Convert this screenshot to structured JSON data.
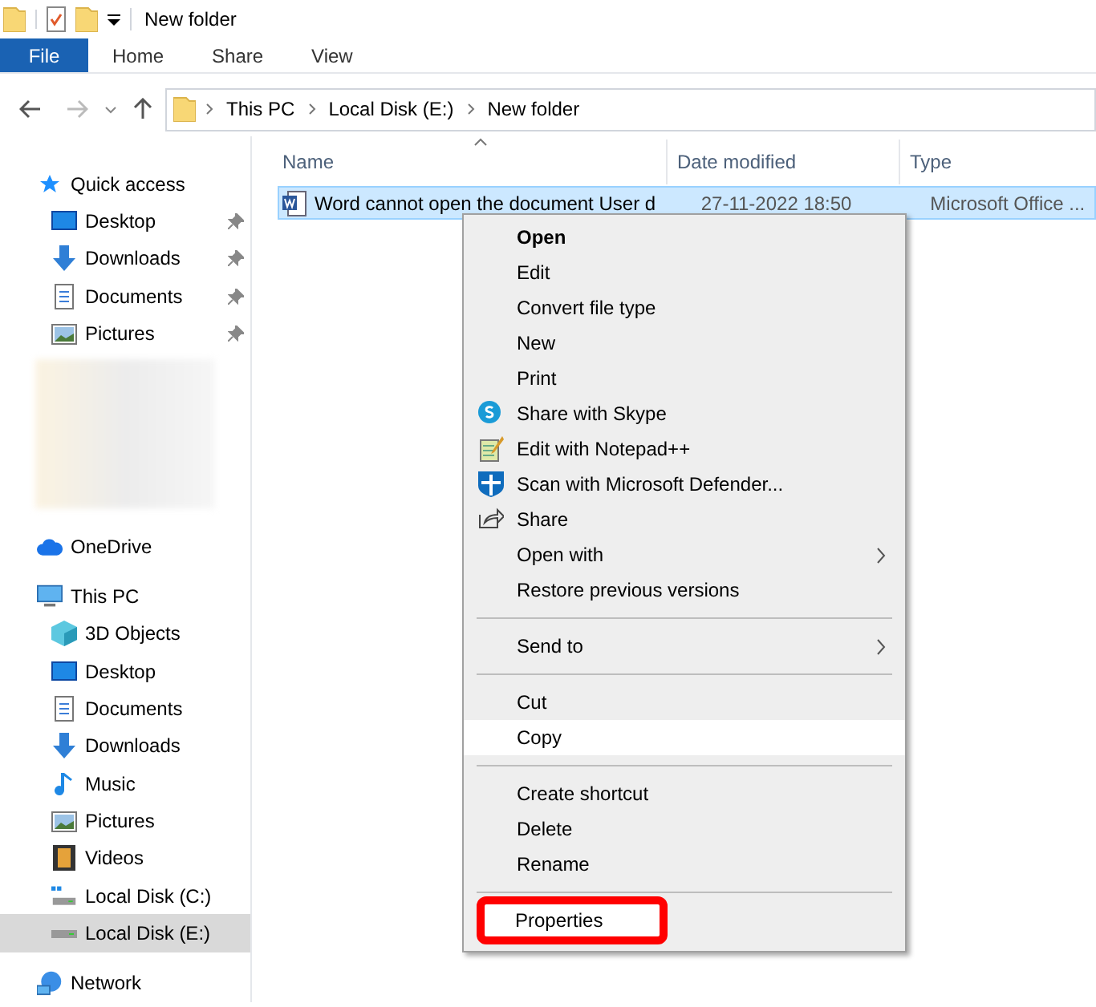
{
  "window": {
    "title": "New folder"
  },
  "ribbon_tabs": [
    {
      "label": "File",
      "selected": true
    },
    {
      "label": "Home",
      "selected": false
    },
    {
      "label": "Share",
      "selected": false
    },
    {
      "label": "View",
      "selected": false
    }
  ],
  "breadcrumb": [
    "This PC",
    "Local Disk (E:)",
    "New folder"
  ],
  "sidebar": {
    "items": [
      {
        "label": "Quick access",
        "selected": false,
        "children": [
          {
            "label": "Desktop",
            "pinned": true,
            "selected": false
          },
          {
            "label": "Downloads",
            "pinned": true,
            "selected": false
          },
          {
            "label": "Documents",
            "pinned": true,
            "selected": false
          },
          {
            "label": "Pictures",
            "pinned": true,
            "selected": false
          }
        ]
      },
      {
        "label": "OneDrive",
        "selected": false
      },
      {
        "label": "This PC",
        "selected": false,
        "children": [
          {
            "label": "3D Objects",
            "pinned": false,
            "selected": false
          },
          {
            "label": "Desktop",
            "pinned": false,
            "selected": false
          },
          {
            "label": "Documents",
            "pinned": false,
            "selected": false
          },
          {
            "label": "Downloads",
            "pinned": false,
            "selected": false
          },
          {
            "label": "Music",
            "pinned": false,
            "selected": false
          },
          {
            "label": "Pictures",
            "pinned": false,
            "selected": false
          },
          {
            "label": "Videos",
            "pinned": false,
            "selected": false
          },
          {
            "label": "Local Disk (C:)",
            "pinned": false,
            "selected": false
          },
          {
            "label": "Local Disk (E:)",
            "pinned": false,
            "selected": true
          }
        ]
      },
      {
        "label": "Network",
        "selected": false
      }
    ]
  },
  "table": {
    "columns": [
      "Name",
      "Date modified",
      "Type"
    ],
    "rows": [
      {
        "cells": [
          "Word cannot open the document User d",
          "27-11-2022 18:50",
          "Microsoft Office ..."
        ],
        "selected": true
      }
    ]
  },
  "context_menu": {
    "groups": [
      [
        {
          "label": "Open",
          "kind": "default",
          "selected": false,
          "marked": false
        },
        {
          "label": "Edit",
          "kind": "normal",
          "selected": false,
          "marked": false
        },
        {
          "label": "Convert file type",
          "kind": "normal",
          "selected": false,
          "marked": false
        },
        {
          "label": "New",
          "kind": "normal",
          "selected": false,
          "marked": false
        },
        {
          "label": "Print",
          "kind": "normal",
          "selected": false,
          "marked": false
        },
        {
          "label": "Share with Skype",
          "kind": "normal",
          "selected": false,
          "marked": false
        },
        {
          "label": "Edit with Notepad++",
          "kind": "normal",
          "selected": false,
          "marked": false
        },
        {
          "label": "Scan with Microsoft Defender...",
          "kind": "normal",
          "selected": false,
          "marked": false
        },
        {
          "label": "Share",
          "kind": "normal",
          "selected": false,
          "marked": false
        },
        {
          "label": "Open with",
          "kind": "submenu",
          "selected": false,
          "marked": false
        },
        {
          "label": "Restore previous versions",
          "kind": "normal",
          "selected": false,
          "marked": false
        }
      ],
      [
        {
          "label": "Send to",
          "kind": "submenu",
          "selected": false,
          "marked": false
        }
      ],
      [
        {
          "label": "Cut",
          "kind": "normal",
          "selected": false,
          "marked": false
        },
        {
          "label": "Copy",
          "kind": "normal",
          "selected": true,
          "marked": false
        }
      ],
      [
        {
          "label": "Create shortcut",
          "kind": "normal",
          "selected": false,
          "marked": false
        },
        {
          "label": "Delete",
          "kind": "normal",
          "selected": false,
          "marked": false
        },
        {
          "label": "Rename",
          "kind": "normal",
          "selected": false,
          "marked": false
        }
      ],
      [
        {
          "label": "Properties",
          "kind": "normal",
          "selected": false,
          "marked": true
        }
      ]
    ]
  }
}
